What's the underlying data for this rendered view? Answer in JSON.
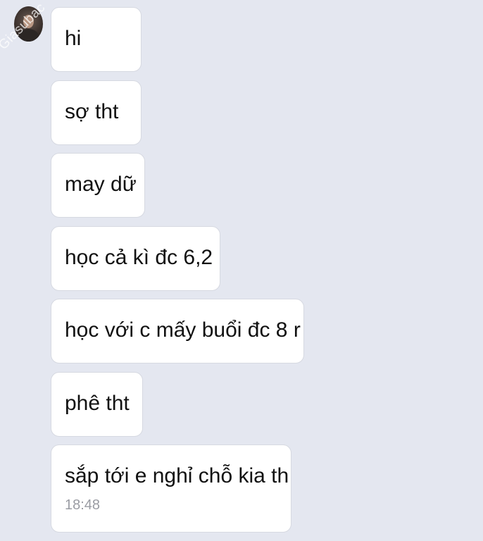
{
  "chat": {
    "watermark": "Giasubac",
    "messages": [
      {
        "text": "hi"
      },
      {
        "text": "sợ tht"
      },
      {
        "text": "may dữ"
      },
      {
        "text": "học cả kì đc 6,2"
      },
      {
        "text": "học với c mấy buổi đc 8 r"
      },
      {
        "text": "phê tht"
      },
      {
        "text": "sắp tới e nghỉ chỗ kia th",
        "time": "18:48"
      }
    ]
  }
}
